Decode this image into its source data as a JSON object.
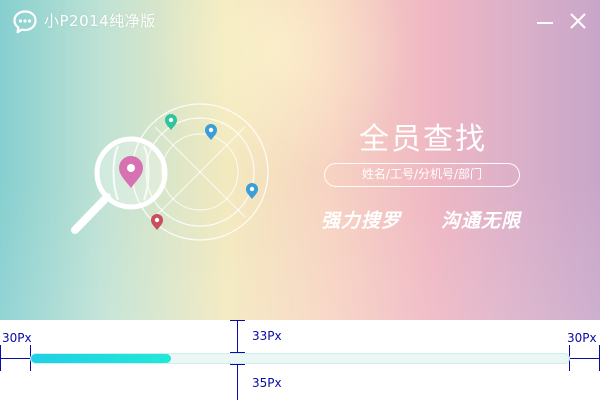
{
  "window": {
    "title": "小P2014纯净版"
  },
  "icons": {
    "logo": "chat-bubble-icon",
    "minimize": "minimize-icon",
    "close": "close-icon",
    "illustration": "magnifier-map-pin-icon"
  },
  "hero": {
    "headline": "全员查找",
    "search_hint": "姓名/工号/分机号/部门",
    "slogans": [
      "强力搜罗",
      "沟通无限"
    ]
  },
  "progress": {
    "value": 0.26
  },
  "annotations": {
    "left_margin": "30Px",
    "right_margin": "30Px",
    "top_spacing": "33Px",
    "bottom_spacing": "35Px"
  },
  "colors": {
    "progress_fill": "#1fd0e6",
    "progress_track": "#eaf7f5",
    "annotation": "#0a0aa8",
    "pin_pink": "#d672b1",
    "pin_green": "#2ec4a0",
    "pin_blue": "#3a9ed8",
    "pin_red": "#c94f5e"
  }
}
